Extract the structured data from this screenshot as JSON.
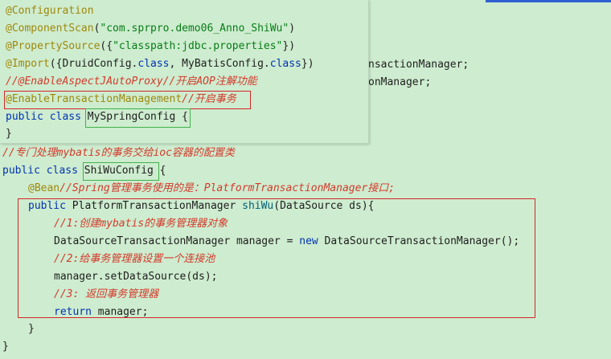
{
  "popup": {
    "lines": [
      {
        "anno": "@Configuration"
      },
      {
        "anno": "@ComponentScan",
        "rest_a": "(",
        "str": "\"com.sprpro.demo06_Anno_ShiWu\"",
        "rest_b": ")"
      },
      {
        "anno": "@PropertySource",
        "rest_a": "({",
        "str": "\"classpath:jdbc.properties\"",
        "rest_b": "})"
      },
      {
        "anno": "@Import",
        "rest_a": "({DruidConfig.",
        "kw1": "class",
        "rest_b": ", MyBatisConfig.",
        "kw2": "class",
        "rest_c": "})"
      },
      {
        "comment": "//@EnableAspectJAutoProxy//开启AOP注解功能"
      },
      {
        "anno": "@EnableTransactionManagement",
        "comment": "//开启事务"
      },
      {
        "kw": "public class ",
        "name": "MySpringConfig",
        "rest": " {"
      },
      {
        "text": "}"
      }
    ]
  },
  "background_fragments": {
    "line1": "nsactionManager;",
    "line2": "onManager;"
  },
  "code": {
    "comment_header": "//专门处理mybatis的事务交给ioc容器的配置类",
    "class_kw": "public class ",
    "class_name": "ShiWuConfig",
    "class_open": " {",
    "bean_anno": "@Bean",
    "bean_comment": "//Spring管理事务使用的是：PlatformTransactionManager接口;",
    "method_kw": "public ",
    "method_type": "PlatformTransactionManager ",
    "method_name": "shiWu",
    "method_params": "(DataSource ds){",
    "c1": "//1:创建mybatis的事务管理器对象",
    "l1_a": "DataSourceTransactionManager manager = ",
    "l1_new": "new",
    "l1_b": " DataSourceTransactionManager();",
    "c2": "//2:给事务管理器设置一个连接池",
    "l2": "manager.setDataSource(ds);",
    "c3": "//3: 返回事务管理器",
    "ret_kw": "return",
    "ret_rest": " manager;",
    "method_close": "}",
    "class_close": "}"
  },
  "colors": {
    "background": "#ceeccf",
    "keyword": "#0033b3",
    "annotation": "#9e880d",
    "string": "#067d17",
    "comment": "#d33a2c",
    "method": "#00627a",
    "red_box": "#d3272a",
    "green_box": "#3fb34a"
  }
}
